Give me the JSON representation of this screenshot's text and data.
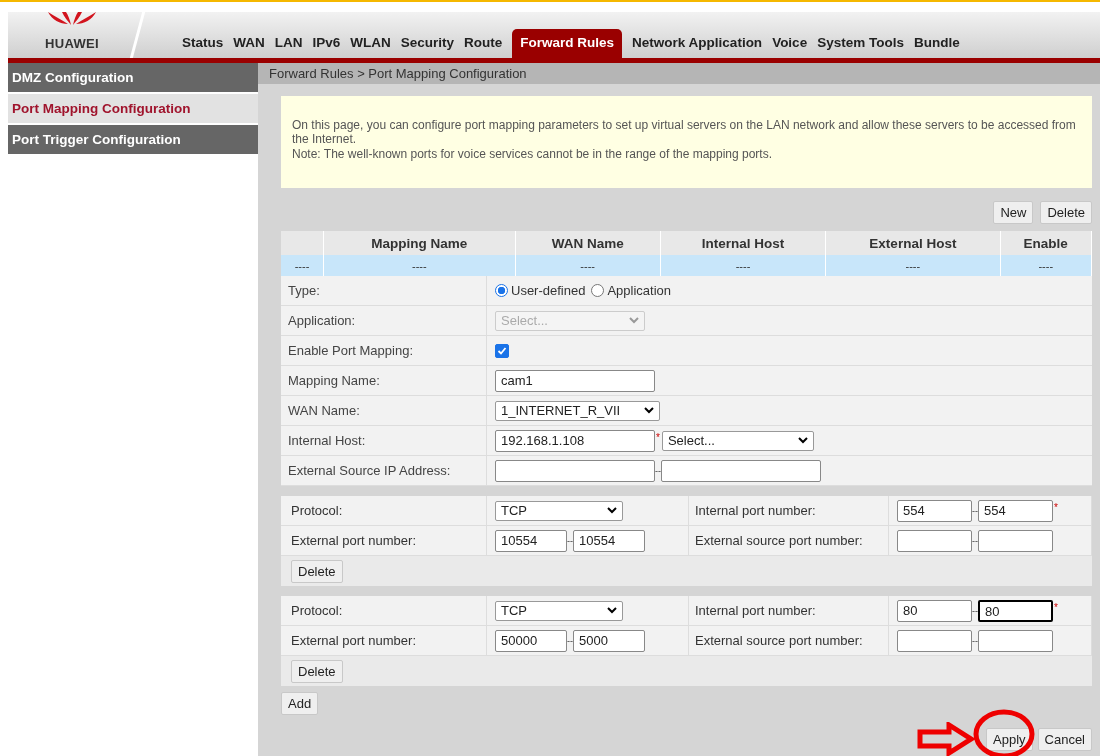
{
  "brand": {
    "name": "HUAWEI"
  },
  "nav": [
    {
      "label": "Status",
      "selected": false
    },
    {
      "label": "WAN",
      "selected": false
    },
    {
      "label": "LAN",
      "selected": false
    },
    {
      "label": "IPv6",
      "selected": false
    },
    {
      "label": "WLAN",
      "selected": false
    },
    {
      "label": "Security",
      "selected": false
    },
    {
      "label": "Route",
      "selected": false
    },
    {
      "label": "Forward Rules",
      "selected": true
    },
    {
      "label": "Network Application",
      "selected": false
    },
    {
      "label": "Voice",
      "selected": false
    },
    {
      "label": "System Tools",
      "selected": false
    },
    {
      "label": "Bundle",
      "selected": false
    }
  ],
  "sidebar": {
    "items": [
      {
        "label": "DMZ Configuration",
        "selected": false
      },
      {
        "label": "Port Mapping Configuration",
        "selected": true
      },
      {
        "label": "Port Trigger Configuration",
        "selected": false
      }
    ]
  },
  "breadcrumb": "Forward Rules > Port Mapping Configuration",
  "info": [
    "On this page, you can configure port mapping parameters to set up virtual servers on the LAN network and allow these servers to be accessed from the Internet.",
    "Note: The well-known ports for voice services cannot be in the range of the mapping ports."
  ],
  "table_buttons": [
    "New",
    "Delete"
  ],
  "table": {
    "columns": [
      "",
      "Mapping Name",
      "WAN Name",
      "Internal Host",
      "External Host",
      "Enable"
    ],
    "rows": [
      [
        "----",
        "----",
        "----",
        "----",
        "----",
        "----"
      ]
    ]
  },
  "form": [
    {
      "kind": "radio",
      "label": "Type:",
      "options": [
        {
          "label": "User-defined",
          "selected": true
        },
        {
          "label": "Application",
          "selected": false
        }
      ]
    },
    {
      "kind": "select",
      "label": "Application:",
      "value": "Select...",
      "disabled": true
    },
    {
      "kind": "checkbox",
      "label": "Enable Port Mapping:",
      "checked": true
    },
    {
      "kind": "text",
      "label": "Mapping Name:",
      "value": "cam1"
    },
    {
      "kind": "select",
      "label": "WAN Name:",
      "value": "1_INTERNET_R_VII",
      "disabled": false
    },
    {
      "kind": "host",
      "label": "Internal Host:",
      "value": "192.168.1.108",
      "required": "*",
      "select": "Select..."
    },
    {
      "kind": "range",
      "label": "External Source IP Address:",
      "separator": "--"
    }
  ],
  "port_rules": [
    {
      "protocol_label": "Protocol:",
      "protocol": "TCP",
      "internal_label": "Internal port number:",
      "internal_from": "554",
      "internal_to": "554",
      "required": "*",
      "external_label": "External port number:",
      "external_from": "10554",
      "external_to": "10554",
      "source_label": "External source port number:",
      "separator": "--",
      "focused": false,
      "delete": "Delete"
    },
    {
      "protocol_label": "Protocol:",
      "protocol": "TCP",
      "internal_label": "Internal port number:",
      "internal_from": "80",
      "internal_to": "80",
      "required": "*",
      "external_label": "External port number:",
      "external_from": "50000",
      "external_to": "5000",
      "source_label": "External source port number:",
      "separator": "--",
      "focused": true,
      "delete": "Delete"
    }
  ],
  "add_button": "Add",
  "actions": [
    "Apply",
    "Cancel"
  ]
}
